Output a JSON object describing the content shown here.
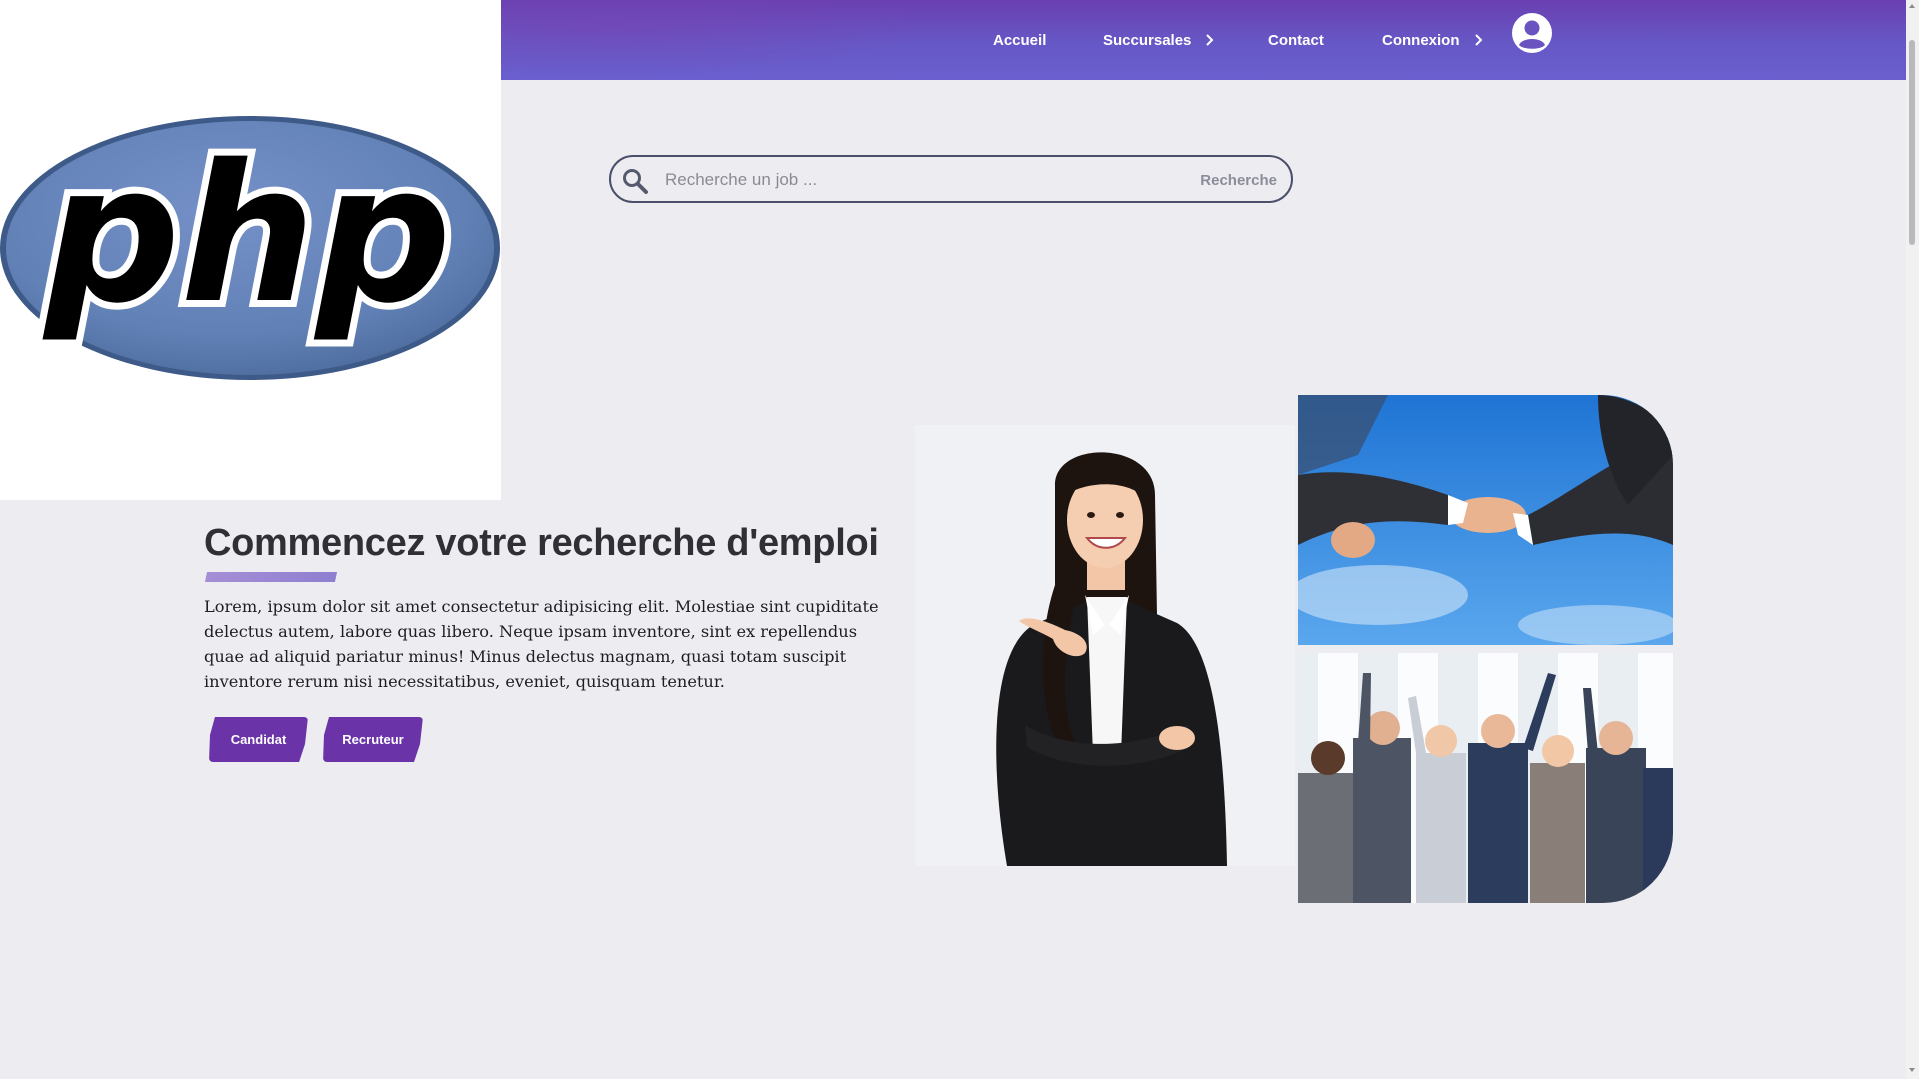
{
  "logo": {
    "text": "php",
    "alt": "PHP logo",
    "colors": {
      "ellipse": "#6181b6",
      "rim": "#4c6a9c",
      "text": "#000000"
    }
  },
  "nav": {
    "items": [
      {
        "label": "Accueil",
        "has_chevron": false
      },
      {
        "label": "Succursales",
        "has_chevron": true
      },
      {
        "label": "Contact",
        "has_chevron": false
      },
      {
        "label": "Connexion",
        "has_chevron": true
      }
    ],
    "avatar_icon": "user-circle-icon",
    "colors": {
      "gradient_top": "#6a3fb0",
      "gradient_bottom": "#6a5fce"
    }
  },
  "search": {
    "placeholder": "Recherche un job ...",
    "value": "",
    "button_label": "Recherche",
    "icon": "search-icon"
  },
  "hero": {
    "title": "Commencez votre recherche d'emploi",
    "text": "Lorem, ipsum dolor sit amet consectetur adipisicing elit. Molestiae sint cupiditate delectus autem, labore quas libero. Neque ipsam inventore, sint ex repellendus quae ad aliquid pariatur minus! Minus delectus magnam, quasi totam suscipit inventore rerum nisi necessitatibus, eveniet, quisquam tenetur.",
    "buttons": {
      "candidat": "Candidat",
      "recruteur": "Recruteur"
    },
    "accent_color": "#6a33a8"
  },
  "images": {
    "woman": "businesswoman-pointing-photo",
    "handshake": "handshake-photo",
    "team": "celebrating-team-photo"
  }
}
